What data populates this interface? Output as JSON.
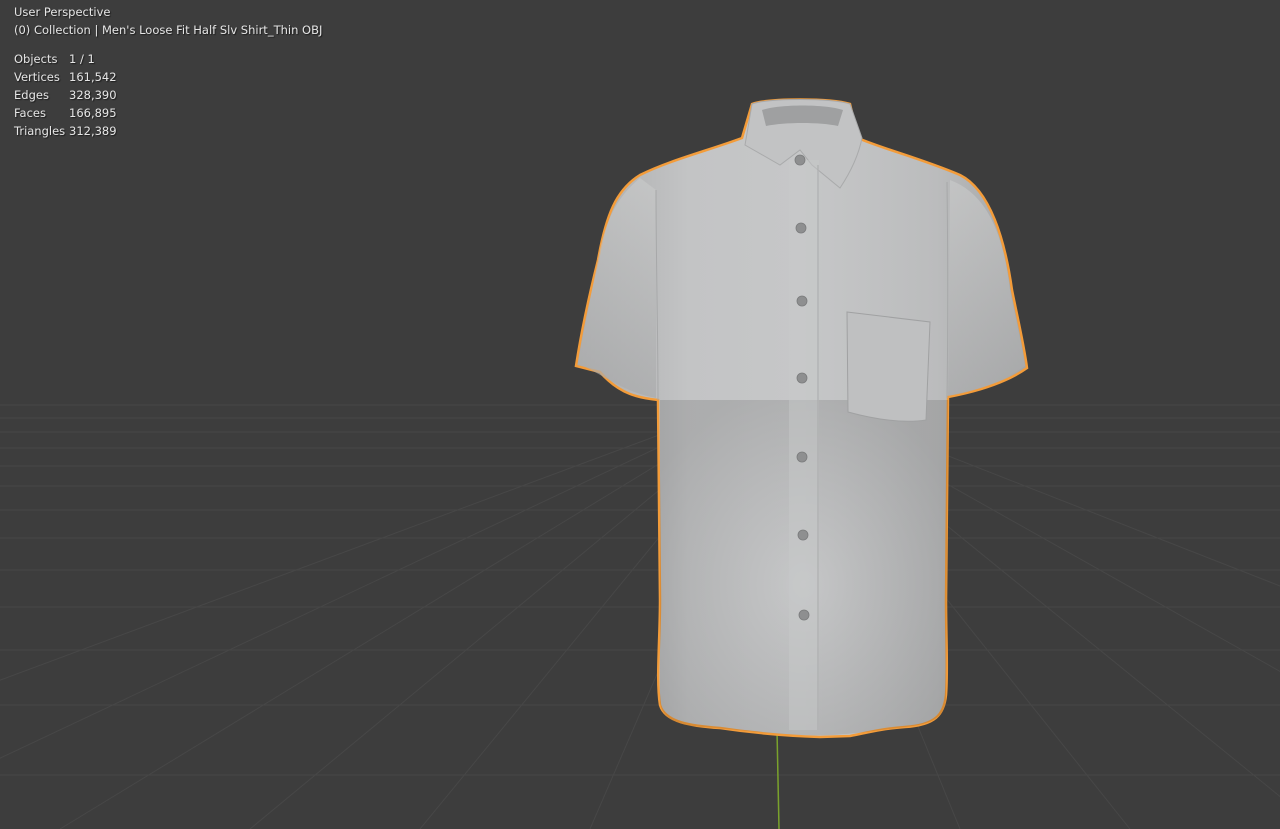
{
  "viewport": {
    "view_name": "User Perspective",
    "collection_line": "(0) Collection | Men's Loose  Fit Half Slv Shirt_Thin OBJ"
  },
  "stats": [
    {
      "label": "Objects",
      "value": "1 / 1"
    },
    {
      "label": "Vertices",
      "value": "161,542"
    },
    {
      "label": "Edges",
      "value": "328,390"
    },
    {
      "label": "Faces",
      "value": "166,895"
    },
    {
      "label": "Triangles",
      "value": "312,389"
    }
  ],
  "colors": {
    "background": "#3d3d3d",
    "grid_line": "#4a4a4a",
    "selection_outline": "#f39c3a",
    "shirt_fill": "#bdbebf",
    "axis_y": "#7aa22c"
  },
  "objects": {
    "selected_object_icon": "shirt-mesh"
  }
}
